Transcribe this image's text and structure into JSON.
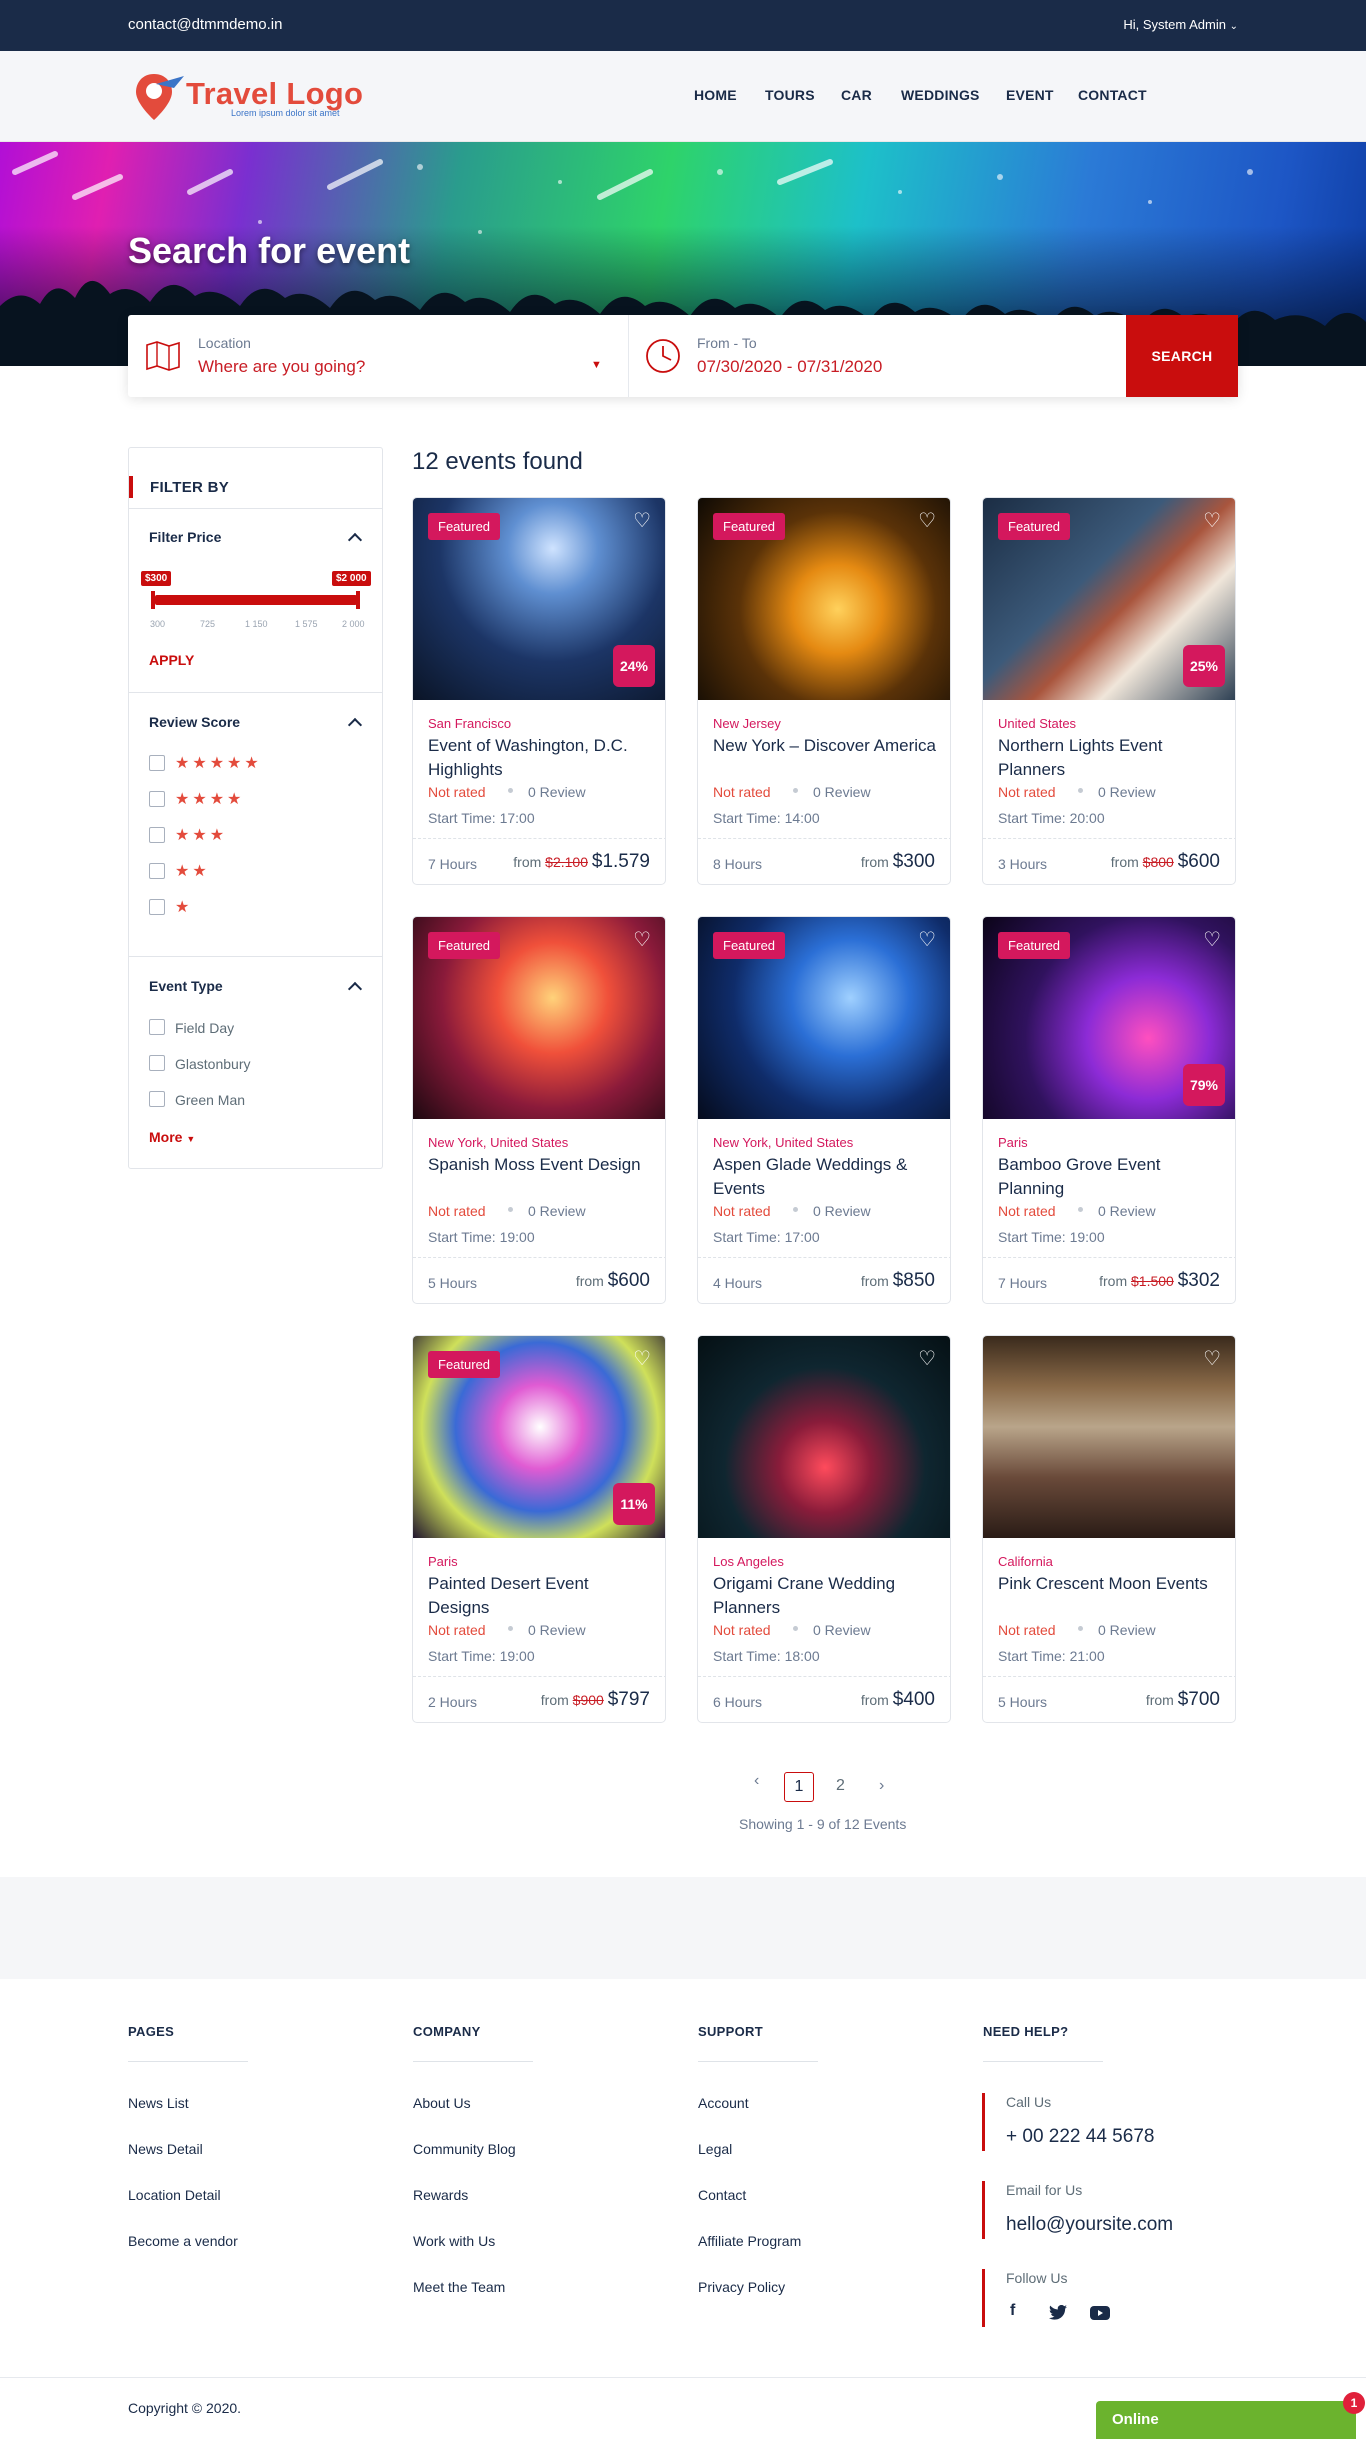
{
  "topbar": {
    "email": "contact@dtmmdemo.in",
    "user": "Hi, System Admin"
  },
  "logo": {
    "name": "Travel Logo",
    "tagline": "Lorem ipsum dolor sit amet"
  },
  "nav": [
    "HOME",
    "TOURS",
    "CAR",
    "WEDDINGS",
    "EVENT",
    "CONTACT"
  ],
  "hero": {
    "title": "Search for event"
  },
  "search": {
    "location_label": "Location",
    "location_value": "Where are you going?",
    "date_label": "From - To",
    "date_value": "07/30/2020 - 07/31/2020",
    "button": "SEARCH"
  },
  "filter": {
    "title": "FILTER BY",
    "price": {
      "title": "Filter Price",
      "min_label": "$300",
      "max_label": "$2 000",
      "ticks": [
        "300",
        "725",
        "1 150",
        "1 575",
        "2 000"
      ],
      "range": [
        300,
        2000
      ],
      "selected": [
        300,
        2000
      ],
      "apply": "APPLY"
    },
    "review": {
      "title": "Review Score",
      "options": [
        5,
        4,
        3,
        2,
        1
      ]
    },
    "type": {
      "title": "Event Type",
      "options": [
        "Field Day",
        "Glastonbury",
        "Green Man"
      ],
      "more": "More"
    }
  },
  "results": {
    "count": "12 events found"
  },
  "common": {
    "featured": "Featured",
    "not_rated": "Not rated",
    "from": "from"
  },
  "events": [
    {
      "location": "San Francisco",
      "title": "Event of Washington, D.C. Highlights",
      "featured": true,
      "discount": "24%",
      "reviews": "0 Review",
      "start": "Start Time: 17:00",
      "duration": "7 Hours",
      "old_price": "$2.100",
      "price": "$1.579"
    },
    {
      "location": "New Jersey",
      "title": "New York – Discover America",
      "featured": true,
      "discount": "",
      "reviews": "0 Review",
      "start": "Start Time: 14:00",
      "duration": "8 Hours",
      "old_price": "",
      "price": "$300"
    },
    {
      "location": "United States",
      "title": "Northern Lights Event Planners",
      "featured": true,
      "discount": "25%",
      "reviews": "0 Review",
      "start": "Start Time: 20:00",
      "duration": "3 Hours",
      "old_price": "$800",
      "price": "$600"
    },
    {
      "location": "New York, United States",
      "title": "Spanish Moss Event Design",
      "featured": true,
      "discount": "",
      "reviews": "0 Review",
      "start": "Start Time: 19:00",
      "duration": "5 Hours",
      "old_price": "",
      "price": "$600"
    },
    {
      "location": "New York, United States",
      "title": "Aspen Glade Weddings & Events",
      "featured": true,
      "discount": "",
      "reviews": "0 Review",
      "start": "Start Time: 17:00",
      "duration": "4 Hours",
      "old_price": "",
      "price": "$850"
    },
    {
      "location": "Paris",
      "title": "Bamboo Grove Event Planning",
      "featured": true,
      "discount": "79%",
      "reviews": "0 Review",
      "start": "Start Time: 19:00",
      "duration": "7 Hours",
      "old_price": "$1.500",
      "price": "$302"
    },
    {
      "location": "Paris",
      "title": "Painted Desert Event Designs",
      "featured": true,
      "discount": "11%",
      "reviews": "0 Review",
      "start": "Start Time: 19:00",
      "duration": "2 Hours",
      "old_price": "$900",
      "price": "$797"
    },
    {
      "location": "Los Angeles",
      "title": "Origami Crane Wedding Planners",
      "featured": false,
      "discount": "",
      "reviews": "0 Review",
      "start": "Start Time: 18:00",
      "duration": "6 Hours",
      "old_price": "",
      "price": "$400"
    },
    {
      "location": "California",
      "title": "Pink Crescent Moon Events",
      "featured": false,
      "discount": "",
      "reviews": "0 Review",
      "start": "Start Time: 21:00",
      "duration": "5 Hours",
      "old_price": "",
      "price": "$700"
    }
  ],
  "pagination": {
    "prev": "‹",
    "pages": [
      "1",
      "2"
    ],
    "next": "›",
    "summary": "Showing 1 - 9 of 12 Events"
  },
  "footer": {
    "pages": {
      "title": "PAGES",
      "links": [
        "News List",
        "News Detail",
        "Location Detail",
        "Become a vendor"
      ]
    },
    "company": {
      "title": "COMPANY",
      "links": [
        "About Us",
        "Community Blog",
        "Rewards",
        "Work with Us",
        "Meet the Team"
      ]
    },
    "support": {
      "title": "SUPPORT",
      "links": [
        "Account",
        "Legal",
        "Contact",
        "Affiliate Program",
        "Privacy Policy"
      ]
    },
    "help": {
      "title": "NEED HELP?",
      "call_label": "Call Us",
      "call_value": "+ 00 222 44 5678",
      "email_label": "Email for Us",
      "email_value": "hello@yoursite.com",
      "follow_label": "Follow Us",
      "social": [
        "f",
        "twitter-icon",
        "youtube-icon"
      ]
    },
    "copyright": "Copyright © 2020."
  },
  "chat": {
    "label": "Online",
    "count": "1"
  },
  "colors": {
    "primary": "#c90d0d",
    "navy": "#1a2b48",
    "pink": "#d4185d",
    "green": "#6bb32e"
  }
}
